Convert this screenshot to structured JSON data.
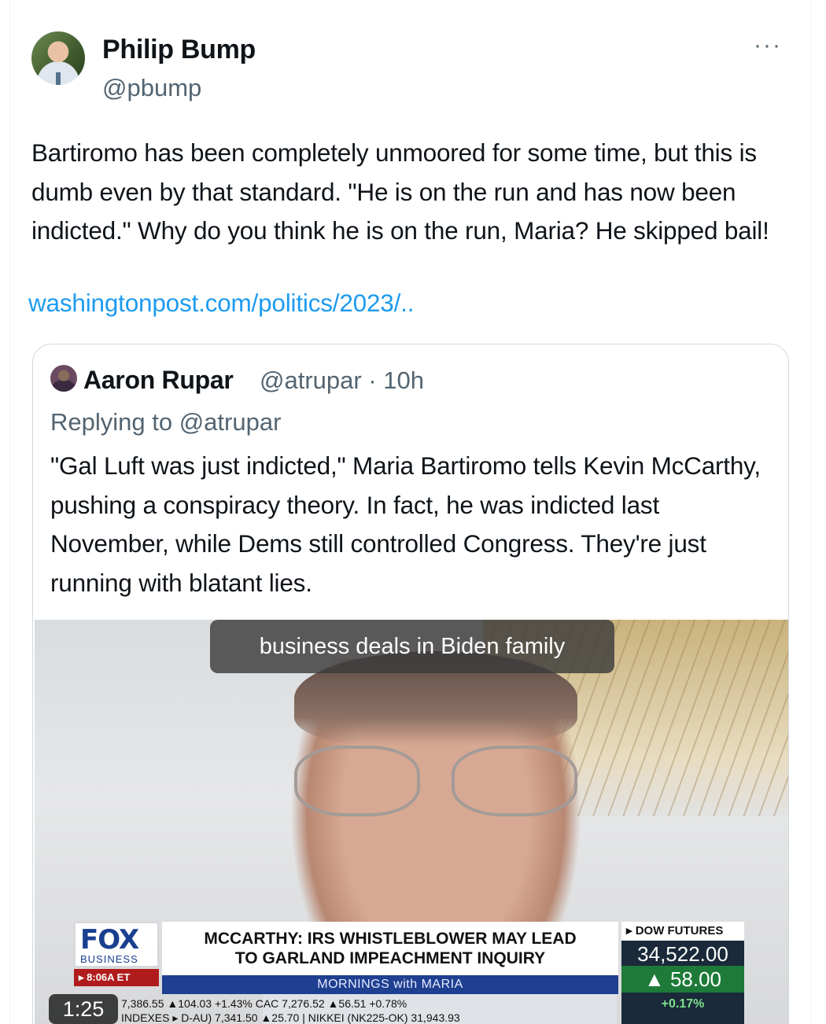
{
  "tweet": {
    "author_name": "Philip Bump",
    "author_handle": "@pbump",
    "more_label": "···",
    "text": "Bartiromo has been completely unmoored for some time, but this is dumb even by that standard. \"He is on the run and has now been indicted.\" Why do you think he is on the run, Maria? He skipped bail!",
    "link": "washingtonpost.com/politics/2023/.."
  },
  "quote": {
    "author_name": "Aaron Rupar",
    "meta": "@atrupar · 10h",
    "replying_to": "Replying to @atrupar",
    "text": "\"Gal Luft was just indicted,\" Maria Bartiromo tells Kevin McCarthy, pushing a conspiracy theory. In fact, he was indicted last November, while Dems still controlled Congress. They're just running with blatant lies.",
    "video": {
      "caption": "business deals in Biden family",
      "duration": "1:25",
      "fox_word": "FOX",
      "fox_sub": "BUSINESS",
      "time_badge": "▸ 8:06A ET",
      "headline_line1": "MCCARTHY: IRS WHISTLEBLOWER MAY LEAD",
      "headline_line2": "TO GARLAND IMPEACHMENT INQUIRY",
      "show": "MORNINGS with MARIA",
      "dow_label": "▸ DOW FUTURES",
      "dow_value": "34,522.00",
      "dow_change": "▲ 58.00",
      "dow_pct": "+0.17%",
      "markets_row1": "7,386.55 ▲104.03 +1.43% CAC        7,276.52 ▲56.51 +0.78%",
      "markets_row2": "INDEXES ▸ D-AU) 7,341.50 ▲25.70 | NIKKEI (NK225-OK) 31,943.93"
    }
  }
}
